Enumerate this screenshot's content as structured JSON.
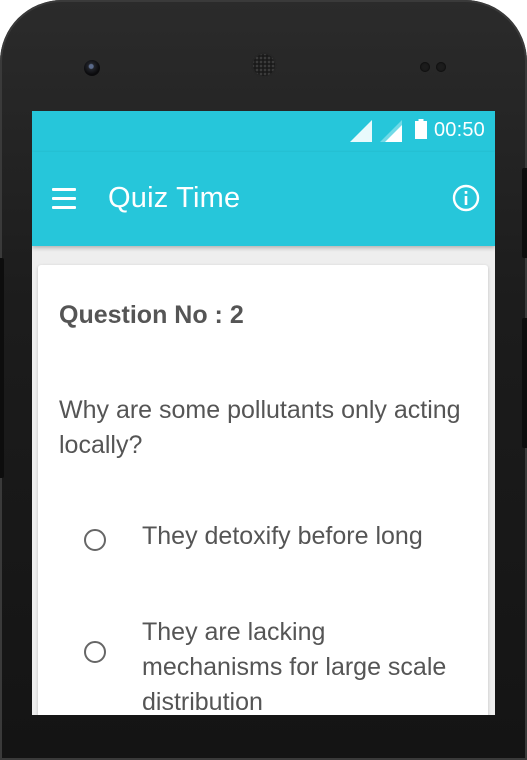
{
  "status_bar": {
    "time": "00:50",
    "icons": [
      "wifi-signal-icon",
      "cell-signal-icon",
      "battery-icon"
    ]
  },
  "app_bar": {
    "title": "Quiz Time",
    "menu_icon": "hamburger-menu-icon",
    "info_icon": "info-icon"
  },
  "quiz": {
    "question_number": "Question No : 2",
    "question_text": "Why are some pollutants only acting locally?",
    "options": [
      {
        "label": "They detoxify before long",
        "selected": false
      },
      {
        "label": "They are lacking mechanisms for large scale distribution",
        "selected": false
      }
    ]
  },
  "colors": {
    "accent": "#26c6da",
    "text": "#555555",
    "card": "#ffffff",
    "background": "#eeeeee"
  }
}
